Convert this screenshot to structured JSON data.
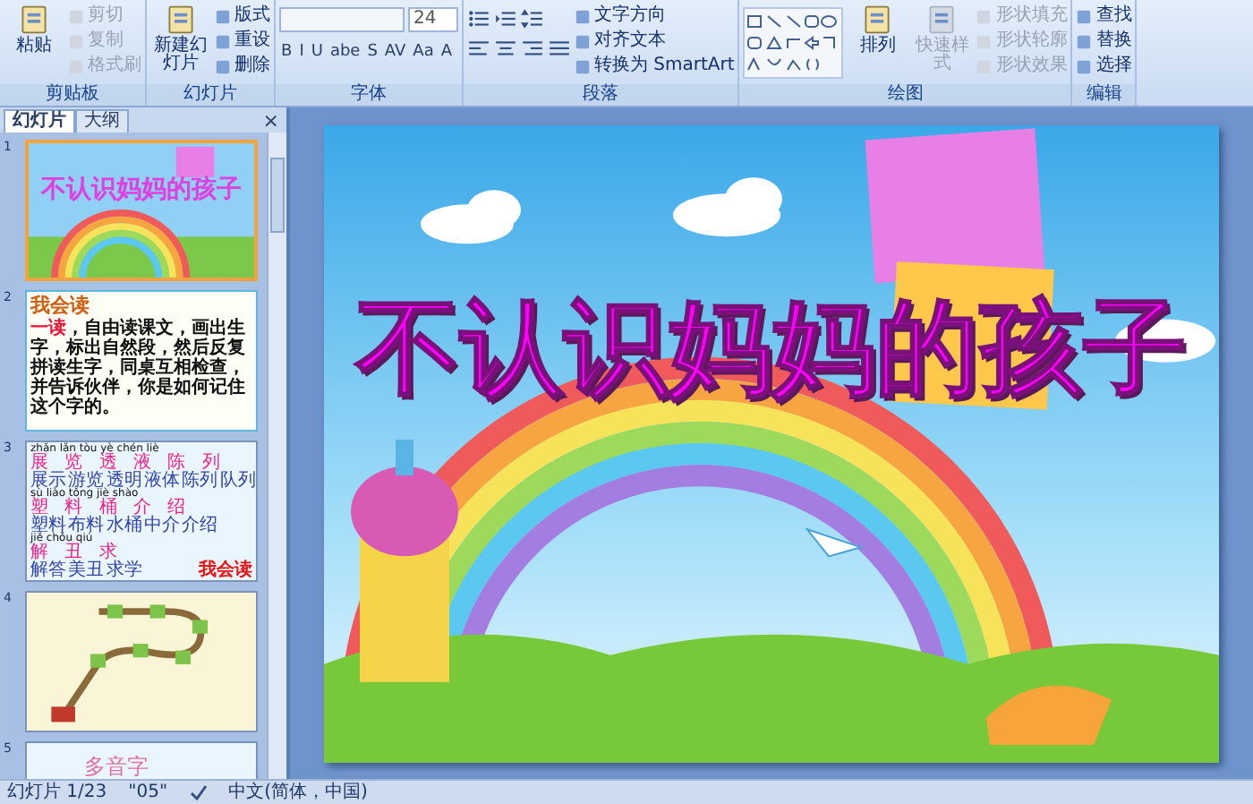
{
  "ribbon": {
    "groups": [
      {
        "label": "剪贴板",
        "items": [
          {
            "kind": "large",
            "label": "粘贴",
            "disabled": false
          },
          {
            "kind": "small",
            "label": "剪切",
            "disabled": true
          },
          {
            "kind": "small",
            "label": "复制",
            "disabled": true
          },
          {
            "kind": "small",
            "label": "格式刷",
            "disabled": true
          }
        ]
      },
      {
        "label": "幻灯片",
        "items": [
          {
            "kind": "large",
            "label": "新建幻灯片",
            "disabled": false
          },
          {
            "kind": "small",
            "label": "版式",
            "disabled": false
          },
          {
            "kind": "small",
            "label": "重设",
            "disabled": false
          },
          {
            "kind": "small",
            "label": "删除",
            "disabled": false
          }
        ]
      },
      {
        "label": "字体",
        "items": [
          {
            "kind": "font",
            "size": "24",
            "buttons": [
              "B",
              "I",
              "U",
              "abe",
              "S",
              "AV",
              "Aa",
              "A"
            ]
          }
        ]
      },
      {
        "label": "段落",
        "items": [
          {
            "kind": "paragraph"
          },
          {
            "kind": "small",
            "label": "文字方向",
            "disabled": false
          },
          {
            "kind": "small",
            "label": "对齐文本",
            "disabled": false
          },
          {
            "kind": "small",
            "label": "转换为 SmartArt",
            "disabled": false
          }
        ]
      },
      {
        "label": "绘图",
        "items": [
          {
            "kind": "gallery"
          },
          {
            "kind": "large",
            "label": "排列",
            "disabled": false
          },
          {
            "kind": "large",
            "label": "快速样式",
            "disabled": true
          },
          {
            "kind": "small",
            "label": "形状填充",
            "disabled": true
          },
          {
            "kind": "small",
            "label": "形状轮廓",
            "disabled": true
          },
          {
            "kind": "small",
            "label": "形状效果",
            "disabled": true
          }
        ]
      },
      {
        "label": "编辑",
        "items": [
          {
            "kind": "small",
            "label": "查找",
            "disabled": false
          },
          {
            "kind": "small",
            "label": "替换",
            "disabled": false
          },
          {
            "kind": "small",
            "label": "选择",
            "disabled": false
          }
        ]
      }
    ]
  },
  "panel": {
    "tabs": [
      {
        "label": "幻灯片",
        "selected": true
      },
      {
        "label": "大纲",
        "selected": false
      }
    ],
    "close": "×",
    "slides": [
      {
        "number": "1",
        "selected": true,
        "kind": "title",
        "title": "不认识妈妈的孩子"
      },
      {
        "number": "2",
        "selected": false,
        "kind": "reading",
        "heading": "我会读",
        "body": "**一读**，自由读课文，画出生字，标出自然段，然后反复拼读生字，同桌互相检查，并告诉伙伴，你是如何记住这个字的。"
      },
      {
        "number": "3",
        "selected": false,
        "kind": "words",
        "stamp": "我会读",
        "lines": [
          {
            "kind": "pinyin",
            "text": "zhǎn lǎn tòu yè chén liè"
          },
          {
            "kind": "hanzi",
            "text": "展 览 透 液 陈 列"
          },
          {
            "kind": "words",
            "text": "展示 游览 透明 液体 陈列 队列"
          },
          {
            "kind": "pinyin",
            "text": "sù liào tǒng jiè shào"
          },
          {
            "kind": "hanzi",
            "text": "塑 料 桶 介 绍"
          },
          {
            "kind": "words",
            "text": "塑料 布料 水桶 中介 介绍"
          },
          {
            "kind": "pinyin",
            "text": "jiě chǒu qiú"
          },
          {
            "kind": "hanzi",
            "text": "解 丑 求"
          },
          {
            "kind": "words",
            "text": "解答 美丑 求学"
          }
        ]
      },
      {
        "number": "4",
        "selected": false,
        "kind": "train"
      },
      {
        "number": "5",
        "selected": false,
        "kind": "heading",
        "heading": "多音字"
      }
    ]
  },
  "slide": {
    "title": "不认识妈妈的孩子"
  },
  "status": {
    "position": "幻灯片 1/23",
    "theme": "\"05\"",
    "language": "中文(简体，中国)"
  }
}
